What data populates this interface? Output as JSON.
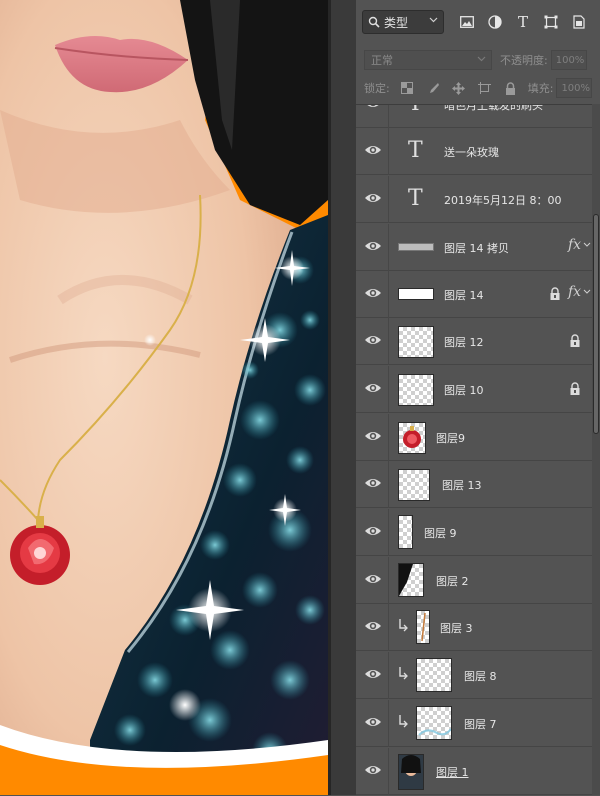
{
  "filter": {
    "label": "类型",
    "icons": [
      "image-filter-icon",
      "adjustment-filter-icon",
      "text-filter-icon",
      "shape-filter-icon",
      "smart-object-filter-icon"
    ],
    "text_icon_glyph": "T"
  },
  "blend": {
    "mode": "正常",
    "opacity_label": "不透明度:",
    "opacity_value": "100%",
    "lock_label": "锁定:",
    "fill_label": "填充:",
    "fill_value": "100%"
  },
  "layers": [
    {
      "name": "暗色月上载发的刷头",
      "type": "text"
    },
    {
      "name": "送一朵玫瑰",
      "type": "text"
    },
    {
      "name": "2019年5月12日  8：00",
      "type": "text"
    },
    {
      "name": "图层 14 拷贝",
      "type": "pixel",
      "fx": "fx"
    },
    {
      "name": "图层 14",
      "type": "pixel",
      "fx": "fx",
      "locked": true
    },
    {
      "name": "图层 12",
      "type": "pixel",
      "locked": true
    },
    {
      "name": "图层 10",
      "type": "pixel",
      "locked": true
    },
    {
      "name": "图层9",
      "type": "pixel"
    },
    {
      "name": "图层 13",
      "type": "pixel"
    },
    {
      "name": "图层 9",
      "type": "pixel"
    },
    {
      "name": "图层 2",
      "type": "pixel"
    },
    {
      "name": "图层 3",
      "type": "pixel",
      "clipped": true
    },
    {
      "name": "图层 8",
      "type": "pixel",
      "clipped": true
    },
    {
      "name": "图层 7",
      "type": "pixel",
      "clipped": true
    },
    {
      "name": "图层 1",
      "type": "pixel"
    }
  ],
  "colors": {
    "panel_bg": "#535353",
    "accent_orange": "#ff8a00",
    "skin": "#f0c9ad",
    "dress": "#0e2430",
    "hair": "#141414"
  }
}
